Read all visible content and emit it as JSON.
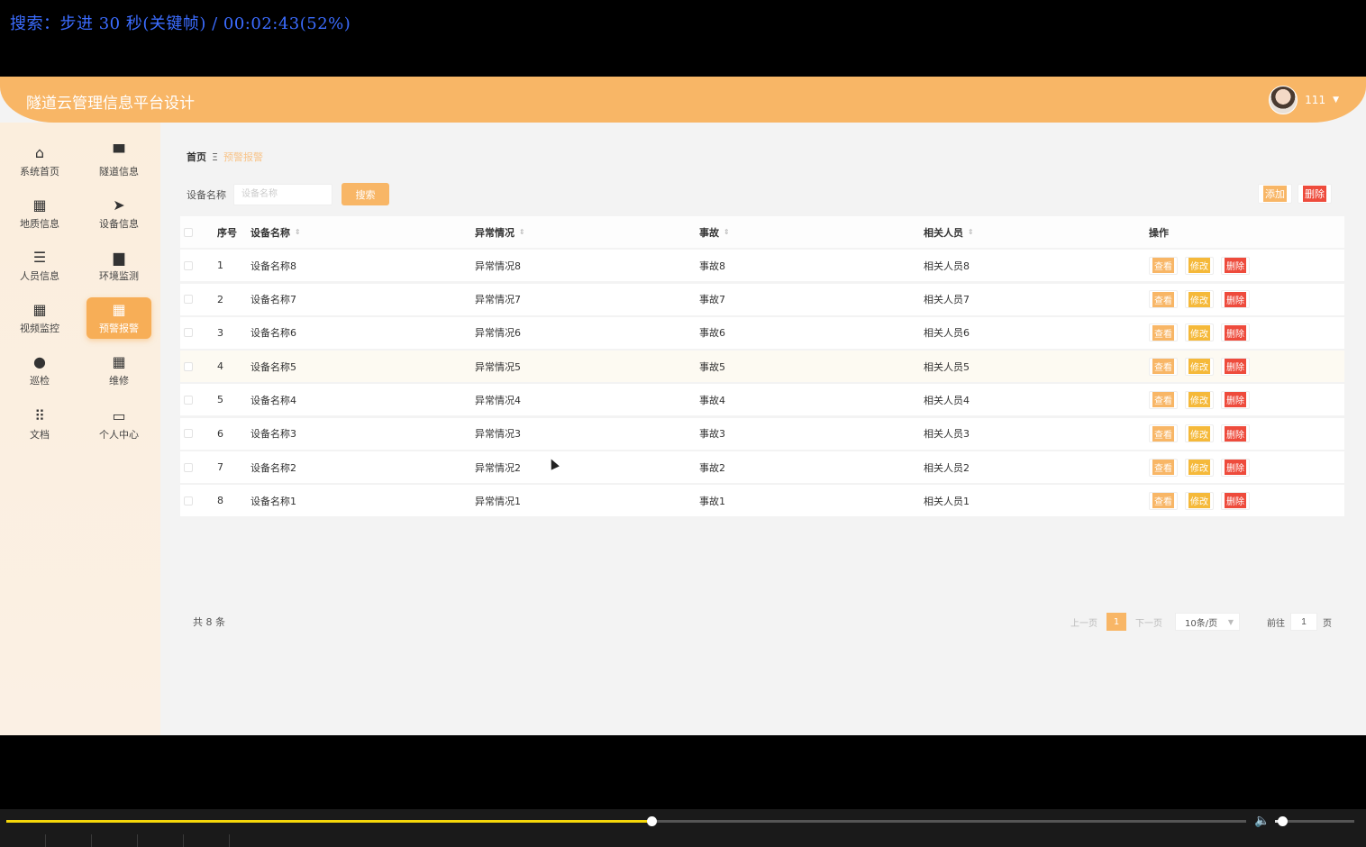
{
  "osd": {
    "text": "搜索：步进 30 秒(关键帧) / 00:02:43(52%)"
  },
  "header": {
    "title": "隧道云管理信息平台设计",
    "user": "111"
  },
  "sidebar": {
    "items": [
      {
        "label": "系统首页",
        "icon": "⌂",
        "icon_name": "home-icon"
      },
      {
        "label": "隧道信息",
        "icon": "▀",
        "icon_name": "message-icon"
      },
      {
        "label": "地质信息",
        "icon": "▦",
        "icon_name": "grid-icon"
      },
      {
        "label": "设备信息",
        "icon": "➤",
        "icon_name": "send-icon"
      },
      {
        "label": "人员信息",
        "icon": "☰",
        "icon_name": "list-icon"
      },
      {
        "label": "环境监测",
        "icon": "▆",
        "icon_name": "monitor-icon"
      },
      {
        "label": "视频监控",
        "icon": "▦",
        "icon_name": "grid-icon"
      },
      {
        "label": "预警报警",
        "icon": "▦",
        "icon_name": "grid-icon",
        "active": true
      },
      {
        "label": "巡检",
        "icon": "●",
        "icon_name": "location-icon"
      },
      {
        "label": "维修",
        "icon": "▦",
        "icon_name": "grid-icon"
      },
      {
        "label": "文档",
        "icon": "⠿",
        "icon_name": "apps-icon"
      },
      {
        "label": "个人中心",
        "icon": "▭",
        "icon_name": "card-icon"
      }
    ]
  },
  "breadcrumb": {
    "home": "首页",
    "separator": "Ξ",
    "current": "预警报警"
  },
  "search": {
    "label": "设备名称",
    "placeholder": "设备名称",
    "button": "搜索"
  },
  "toolbar": {
    "add": "添加",
    "delete": "删除"
  },
  "table": {
    "headers": {
      "index": "序号",
      "name": "设备名称",
      "abnormal": "异常情况",
      "accident": "事故",
      "person": "相关人员",
      "ops": "操作"
    },
    "op_labels": {
      "view": "查看",
      "edit": "修改",
      "delete": "删除"
    },
    "rows": [
      {
        "index": "1",
        "name": "设备名称8",
        "abnormal": "异常情况8",
        "accident": "事故8",
        "person": "相关人员8"
      },
      {
        "index": "2",
        "name": "设备名称7",
        "abnormal": "异常情况7",
        "accident": "事故7",
        "person": "相关人员7"
      },
      {
        "index": "3",
        "name": "设备名称6",
        "abnormal": "异常情况6",
        "accident": "事故6",
        "person": "相关人员6"
      },
      {
        "index": "4",
        "name": "设备名称5",
        "abnormal": "异常情况5",
        "accident": "事故5",
        "person": "相关人员5"
      },
      {
        "index": "5",
        "name": "设备名称4",
        "abnormal": "异常情况4",
        "accident": "事故4",
        "person": "相关人员4"
      },
      {
        "index": "6",
        "name": "设备名称3",
        "abnormal": "异常情况3",
        "accident": "事故3",
        "person": "相关人员3"
      },
      {
        "index": "7",
        "name": "设备名称2",
        "abnormal": "异常情况2",
        "accident": "事故2",
        "person": "相关人员2"
      },
      {
        "index": "8",
        "name": "设备名称1",
        "abnormal": "异常情况1",
        "accident": "事故1",
        "person": "相关人员1"
      }
    ]
  },
  "pagination": {
    "total": "共 8 条",
    "prev": "上一页",
    "page": "1",
    "next": "下一页",
    "size": "10条/页",
    "goto_label": "前往",
    "goto_value": "1",
    "goto_suffix": "页"
  },
  "player": {
    "progress_fraction": 0.52,
    "volume_fraction": 0.09
  }
}
